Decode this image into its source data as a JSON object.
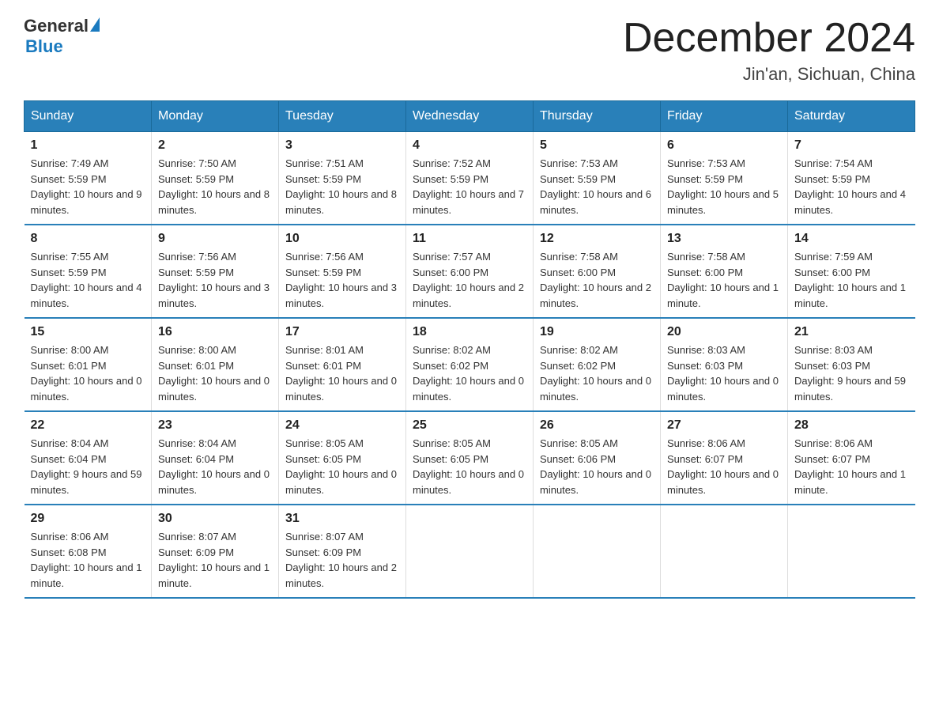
{
  "logo": {
    "text_general": "General",
    "text_blue": "Blue"
  },
  "title": "December 2024",
  "location": "Jin'an, Sichuan, China",
  "days_of_week": [
    "Sunday",
    "Monday",
    "Tuesday",
    "Wednesday",
    "Thursday",
    "Friday",
    "Saturday"
  ],
  "weeks": [
    [
      {
        "day": "1",
        "sunrise": "7:49 AM",
        "sunset": "5:59 PM",
        "daylight": "10 hours and 9 minutes."
      },
      {
        "day": "2",
        "sunrise": "7:50 AM",
        "sunset": "5:59 PM",
        "daylight": "10 hours and 8 minutes."
      },
      {
        "day": "3",
        "sunrise": "7:51 AM",
        "sunset": "5:59 PM",
        "daylight": "10 hours and 8 minutes."
      },
      {
        "day": "4",
        "sunrise": "7:52 AM",
        "sunset": "5:59 PM",
        "daylight": "10 hours and 7 minutes."
      },
      {
        "day": "5",
        "sunrise": "7:53 AM",
        "sunset": "5:59 PM",
        "daylight": "10 hours and 6 minutes."
      },
      {
        "day": "6",
        "sunrise": "7:53 AM",
        "sunset": "5:59 PM",
        "daylight": "10 hours and 5 minutes."
      },
      {
        "day": "7",
        "sunrise": "7:54 AM",
        "sunset": "5:59 PM",
        "daylight": "10 hours and 4 minutes."
      }
    ],
    [
      {
        "day": "8",
        "sunrise": "7:55 AM",
        "sunset": "5:59 PM",
        "daylight": "10 hours and 4 minutes."
      },
      {
        "day": "9",
        "sunrise": "7:56 AM",
        "sunset": "5:59 PM",
        "daylight": "10 hours and 3 minutes."
      },
      {
        "day": "10",
        "sunrise": "7:56 AM",
        "sunset": "5:59 PM",
        "daylight": "10 hours and 3 minutes."
      },
      {
        "day": "11",
        "sunrise": "7:57 AM",
        "sunset": "6:00 PM",
        "daylight": "10 hours and 2 minutes."
      },
      {
        "day": "12",
        "sunrise": "7:58 AM",
        "sunset": "6:00 PM",
        "daylight": "10 hours and 2 minutes."
      },
      {
        "day": "13",
        "sunrise": "7:58 AM",
        "sunset": "6:00 PM",
        "daylight": "10 hours and 1 minute."
      },
      {
        "day": "14",
        "sunrise": "7:59 AM",
        "sunset": "6:00 PM",
        "daylight": "10 hours and 1 minute."
      }
    ],
    [
      {
        "day": "15",
        "sunrise": "8:00 AM",
        "sunset": "6:01 PM",
        "daylight": "10 hours and 0 minutes."
      },
      {
        "day": "16",
        "sunrise": "8:00 AM",
        "sunset": "6:01 PM",
        "daylight": "10 hours and 0 minutes."
      },
      {
        "day": "17",
        "sunrise": "8:01 AM",
        "sunset": "6:01 PM",
        "daylight": "10 hours and 0 minutes."
      },
      {
        "day": "18",
        "sunrise": "8:02 AM",
        "sunset": "6:02 PM",
        "daylight": "10 hours and 0 minutes."
      },
      {
        "day": "19",
        "sunrise": "8:02 AM",
        "sunset": "6:02 PM",
        "daylight": "10 hours and 0 minutes."
      },
      {
        "day": "20",
        "sunrise": "8:03 AM",
        "sunset": "6:03 PM",
        "daylight": "10 hours and 0 minutes."
      },
      {
        "day": "21",
        "sunrise": "8:03 AM",
        "sunset": "6:03 PM",
        "daylight": "9 hours and 59 minutes."
      }
    ],
    [
      {
        "day": "22",
        "sunrise": "8:04 AM",
        "sunset": "6:04 PM",
        "daylight": "9 hours and 59 minutes."
      },
      {
        "day": "23",
        "sunrise": "8:04 AM",
        "sunset": "6:04 PM",
        "daylight": "10 hours and 0 minutes."
      },
      {
        "day": "24",
        "sunrise": "8:05 AM",
        "sunset": "6:05 PM",
        "daylight": "10 hours and 0 minutes."
      },
      {
        "day": "25",
        "sunrise": "8:05 AM",
        "sunset": "6:05 PM",
        "daylight": "10 hours and 0 minutes."
      },
      {
        "day": "26",
        "sunrise": "8:05 AM",
        "sunset": "6:06 PM",
        "daylight": "10 hours and 0 minutes."
      },
      {
        "day": "27",
        "sunrise": "8:06 AM",
        "sunset": "6:07 PM",
        "daylight": "10 hours and 0 minutes."
      },
      {
        "day": "28",
        "sunrise": "8:06 AM",
        "sunset": "6:07 PM",
        "daylight": "10 hours and 1 minute."
      }
    ],
    [
      {
        "day": "29",
        "sunrise": "8:06 AM",
        "sunset": "6:08 PM",
        "daylight": "10 hours and 1 minute."
      },
      {
        "day": "30",
        "sunrise": "8:07 AM",
        "sunset": "6:09 PM",
        "daylight": "10 hours and 1 minute."
      },
      {
        "day": "31",
        "sunrise": "8:07 AM",
        "sunset": "6:09 PM",
        "daylight": "10 hours and 2 minutes."
      },
      null,
      null,
      null,
      null
    ]
  ]
}
